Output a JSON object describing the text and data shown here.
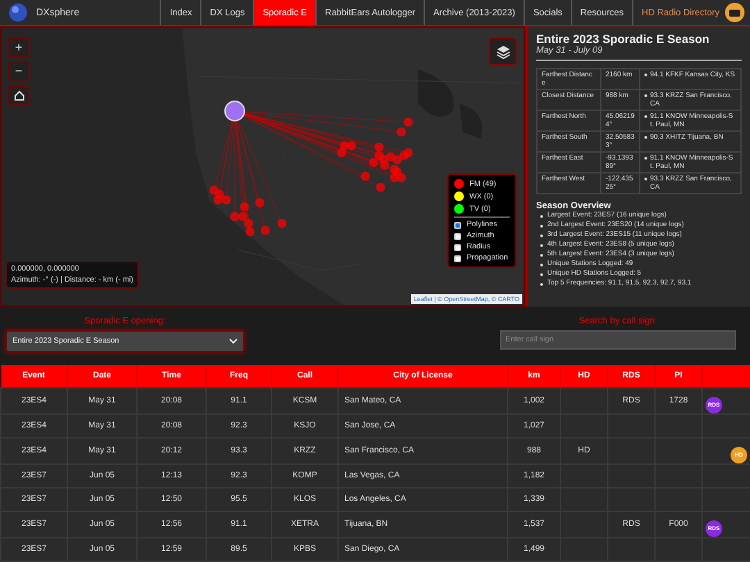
{
  "nav": {
    "brand": "DXsphere",
    "items": [
      {
        "label": "Index",
        "selected": false
      },
      {
        "label": "DX Logs",
        "selected": false
      },
      {
        "label": "Sporadic E",
        "selected": true
      },
      {
        "label": "RabbitEars Autologger",
        "selected": false
      },
      {
        "label": "Archive (2013-2023)",
        "selected": false
      },
      {
        "label": "Socials",
        "selected": false
      },
      {
        "label": "Resources",
        "selected": false
      }
    ],
    "highlight": "HD Radio Directory"
  },
  "map": {
    "zoom_in": "+",
    "zoom_out": "−",
    "coordinates": "0.000000, 0.000000",
    "azimuth": "Azimuth: -° (-) | Distance: - km (- mi)",
    "attribution": "Leaflet | © OpenStreetMap, © CARTO",
    "legend": [
      {
        "label": "FM (49)",
        "color": "#ff0000"
      },
      {
        "label": "WX (0)",
        "color": "#ffff00"
      },
      {
        "label": "TV (0)",
        "color": "#00ff00"
      }
    ],
    "layers": [
      {
        "label": "Polylines",
        "checked": true
      },
      {
        "label": "Azimuth",
        "checked": false
      },
      {
        "label": "Radius",
        "checked": false
      },
      {
        "label": "Propagation",
        "checked": false
      }
    ]
  },
  "summary": {
    "title": "Entire 2023 Sporadic E Season",
    "subtitle": "May 31 - July 09",
    "stats": [
      {
        "label": "Farthest Distance",
        "value": "2160 km",
        "station": "94.1 KFKF Kansas City, KS"
      },
      {
        "label": "Closest Distance",
        "value": "988 km",
        "station": "93.3 KRZZ San Francisco, CA"
      },
      {
        "label": "Farthest North",
        "value": "45.062194°",
        "station": "91.1 KNOW Minneapolis-St. Paul, MN"
      },
      {
        "label": "Farthest South",
        "value": "32.505833°",
        "station": "90.3 XHITZ Tijuana, BN"
      },
      {
        "label": "Farthest East",
        "value": "-93.139389°",
        "station": "91.1 KNOW Minneapolis-St. Paul, MN"
      },
      {
        "label": "Farthest West",
        "value": "-122.43525°",
        "station": "93.3 KRZZ San Francisco, CA"
      }
    ],
    "overview_title": "Season Overview",
    "overview": [
      "Largest Event: 23ES7 (16 unique logs)",
      "2nd Largest Event: 23ES20 (14 unique logs)",
      "3rd Largest Event: 23ES15 (11 unique logs)",
      "4th Largest Event: 23ES8 (5 unique logs)",
      "5th Largest Event: 23ES4 (3 unique logs)",
      "Unique Stations Logged: 49",
      "Unique HD Stations Logged: 5",
      "Top 5 Frequencies: 91.1, 91.5, 92.3, 92.7, 93.1"
    ]
  },
  "filters": {
    "opening_label": "Sporadic E opening:",
    "opening_value": "Entire 2023 Sporadic E Season",
    "search_label": "Search by call sign:",
    "search_placeholder": "Enter call sign"
  },
  "table": {
    "columns": [
      "Event",
      "Date",
      "Time",
      "Freq",
      "Call",
      "City of License",
      "km",
      "HD",
      "RDS",
      "PI"
    ],
    "rows": [
      {
        "cells": [
          "23ES4",
          "May 31",
          "20:08",
          "91.1",
          "KCSM",
          "San Mateo, CA",
          "1,002",
          "",
          "RDS",
          "1728"
        ],
        "badge": {
          "kind": "rds",
          "label": "RDS"
        }
      },
      {
        "cells": [
          "23ES4",
          "May 31",
          "20:08",
          "92.3",
          "KSJO",
          "San Jose, CA",
          "1,027",
          "",
          "",
          ""
        ]
      },
      {
        "cells": [
          "23ES4",
          "May 31",
          "20:12",
          "93.3",
          "KRZZ",
          "San Francisco, CA",
          "988",
          "HD",
          "",
          ""
        ],
        "badge": {
          "kind": "hd",
          "label": "HD"
        }
      },
      {
        "cells": [
          "23ES7",
          "Jun 05",
          "12:13",
          "92.3",
          "KOMP",
          "Las Vegas, CA",
          "1,182",
          "",
          "",
          ""
        ]
      },
      {
        "cells": [
          "23ES7",
          "Jun 05",
          "12:50",
          "95.5",
          "KLOS",
          "Los Angeles, CA",
          "1,339",
          "",
          "",
          ""
        ]
      },
      {
        "cells": [
          "23ES7",
          "Jun 05",
          "12:56",
          "91.1",
          "XETRA",
          "Tijuana, BN",
          "1,537",
          "",
          "RDS",
          "F000"
        ],
        "badge": {
          "kind": "rds",
          "label": "RDS"
        }
      },
      {
        "cells": [
          "23ES7",
          "Jun 05",
          "12:59",
          "89.5",
          "KPBS",
          "San Diego, CA",
          "1,499",
          "",
          "",
          ""
        ]
      }
    ]
  }
}
